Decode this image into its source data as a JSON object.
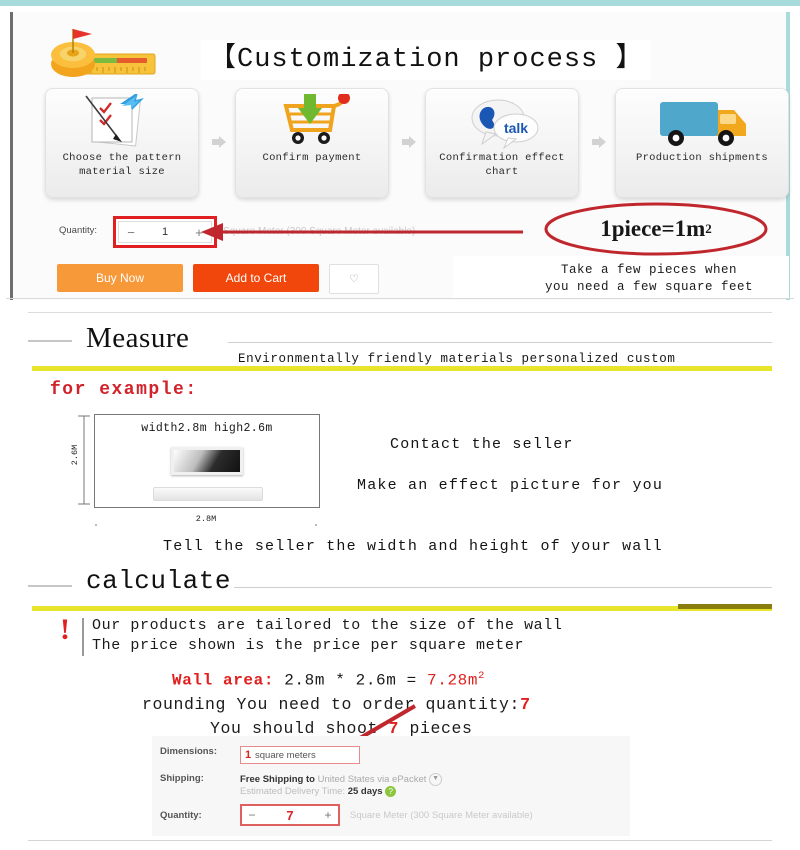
{
  "top": {
    "title": "【Customization process 】",
    "tape_icon": "measuring-tape-icon",
    "steps": [
      {
        "label": "Choose the pattern\nmaterial size",
        "icon": "document-pen-checklist-icon"
      },
      {
        "label": "Confirm payment",
        "icon": "shopping-cart-download-icon"
      },
      {
        "label": "Confirmation effect\nchart",
        "icon": "chat-talk-bubble-icon"
      },
      {
        "label": "Production shipments",
        "icon": "delivery-truck-icon"
      }
    ],
    "quantity": {
      "label": "Quantity:",
      "minus": "−",
      "value": "1",
      "plus": "+",
      "availability": "Square Meter (300 Square Meter available)"
    },
    "callout": {
      "text": "1piece=1m",
      "sup": "2"
    },
    "note": "Take a few pieces when\nyou need a few square feet",
    "buttons": {
      "buy_now": "Buy Now",
      "add_to_cart": "Add to Cart",
      "wishlist_icon": "heart-icon"
    }
  },
  "measure": {
    "heading": "Measure",
    "subtitle": "Environmentally friendly materials personalized custom",
    "for_example": "for example:",
    "diagram": {
      "dims_text": "width2.8m  high2.6m",
      "vertical_label": "2.6M",
      "horizontal_label": "2.8M"
    },
    "right_lines": [
      "Contact the seller",
      "Make an effect picture for you"
    ],
    "tell_seller": "Tell the seller the width and height of your wall"
  },
  "calculate": {
    "heading": "calculate",
    "warning": [
      "Our products are tailored to the size of the wall",
      "The price shown is the price per square meter"
    ],
    "wall_area_label": "Wall area:",
    "wall_area_expr": "2.8m * 2.6m = ",
    "wall_area_result": "7.28m",
    "wall_area_sup": "2",
    "rounding_line": "rounding  You need to order quantity:",
    "rounding_qty": "7",
    "shoot_prefix": "You should shoot ",
    "shoot_qty": "7",
    "shoot_suffix": " pieces"
  },
  "detail_panel": {
    "dimensions_label": "Dimensions:",
    "dimensions_value": "1",
    "dimensions_unit": "square meters",
    "shipping_label": "Shipping:",
    "shipping_strong": "Free Shipping to",
    "shipping_rest": "United States via ePacket",
    "shipping_caret_icon": "chevron-down-icon",
    "eta_prefix": "Estimated Delivery Time: ",
    "eta_value": "25 days",
    "eta_help_icon": "help-icon",
    "quantity_label": "Quantity:",
    "qty_minus": "−",
    "qty_value": "7",
    "qty_plus": "+",
    "qty_availability": "Square Meter (300 Square Meter available)"
  },
  "colors": {
    "teal_border": "#a8dbdc",
    "red_accent": "#e0201f",
    "yellow_bar": "#e8e52a",
    "yellow_bar_dark": "#8a7d10",
    "buy_now": "#f79839",
    "add_to_cart": "#f1470c"
  }
}
